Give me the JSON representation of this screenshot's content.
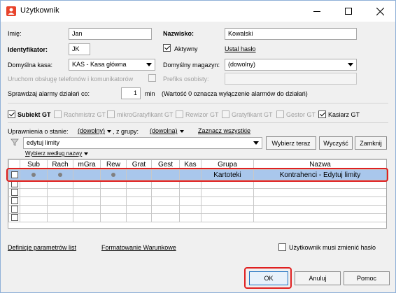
{
  "window": {
    "title": "Użytkownik"
  },
  "form": {
    "imie_label": "Imię:",
    "imie_value": "Jan",
    "nazwisko_label": "Nazwisko:",
    "nazwisko_value": "Kowalski",
    "identyfikator_label": "Identyfikator:",
    "identyfikator_value": "JK",
    "aktywny_label": "Aktywny",
    "aktywny_checked": true,
    "ustal_haslo": "Ustal hasło",
    "kasa_label": "Domyślna kasa:",
    "kasa_value": "KAS - Kasa główna",
    "magazyn_label": "Domyślny magazyn:",
    "magazyn_value": "(dowolny)",
    "telefon_label": "Uruchom obsługę telefonów i komunikatorów",
    "prefiks_label": "Prefiks osobisty:",
    "alarmy_label": "Sprawdzaj alarmy działań co:",
    "alarmy_value": "1",
    "alarmy_unit": "min",
    "alarmy_note": "(Wartość 0 oznacza wyłączenie alarmów do działań)"
  },
  "modules": [
    {
      "label": "Subiekt GT",
      "checked": true,
      "enabled": true
    },
    {
      "label": "Rachmistrz GT",
      "checked": false,
      "enabled": false
    },
    {
      "label": "mikroGratyfikant GT",
      "checked": false,
      "enabled": false
    },
    {
      "label": "Rewizor GT",
      "checked": false,
      "enabled": false
    },
    {
      "label": "Gratyfikant GT",
      "checked": false,
      "enabled": false
    },
    {
      "label": "Gestor GT",
      "checked": false,
      "enabled": false
    },
    {
      "label": "Kasiarz GT",
      "checked": true,
      "enabled": true
    }
  ],
  "permissions": {
    "state_label": "Uprawnienia o stanie:",
    "state_value": "(dowolny)",
    "group_label": ", z grupy:",
    "group_value": "(dowolna)",
    "select_all": "Zaznacz wszystkie",
    "filter_value": "edytuj limity",
    "choose_now": "Wybierz teraz",
    "clear": "Wyczyść",
    "close": "Zamknij",
    "sort_label": "Wybierz według nazwy"
  },
  "grid": {
    "columns": [
      "",
      "Sub",
      "Rach",
      "mGra",
      "Rew",
      "Grat",
      "Gest",
      "Kas",
      "Grupa",
      "Nazwa"
    ],
    "rows": [
      {
        "group": "Kartoteki",
        "name": "Kontrahenci - Edytuj limity",
        "dots": [
          true,
          true,
          false,
          true,
          false,
          false,
          false
        ]
      }
    ],
    "empty_rows": 5
  },
  "footer": {
    "definicje": "Definicje parametrów list",
    "formatowanie": "Formatowanie Warunkowe",
    "must_change": "Użytkownik musi zmienić hasło"
  },
  "buttons": {
    "ok": "OK",
    "cancel": "Anuluj",
    "help": "Pomoc"
  },
  "colors": {
    "selected_row": "#a9c7ec",
    "highlight": "#e02020"
  }
}
